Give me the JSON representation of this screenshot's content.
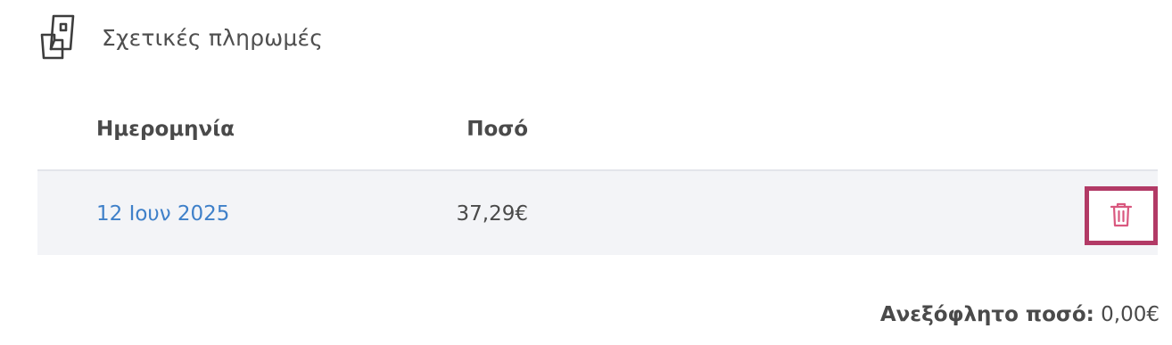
{
  "section": {
    "title": "Σχετικές πληρωμές",
    "icon": "payment-document-icon"
  },
  "table": {
    "headers": {
      "date": "Ημερομηνία",
      "amount": "Ποσό"
    },
    "rows": [
      {
        "date": "12 Ιουν 2025",
        "amount": "37,29€",
        "delete_icon": "trash-icon"
      }
    ]
  },
  "summary": {
    "label": "Ανεξόφλητο ποσό:",
    "value": "0,00€"
  },
  "colors": {
    "link": "#3f80c9",
    "delete_icon": "#d9587f",
    "focus_ring": "#b23a66",
    "row_bg": "#f3f4f7"
  }
}
